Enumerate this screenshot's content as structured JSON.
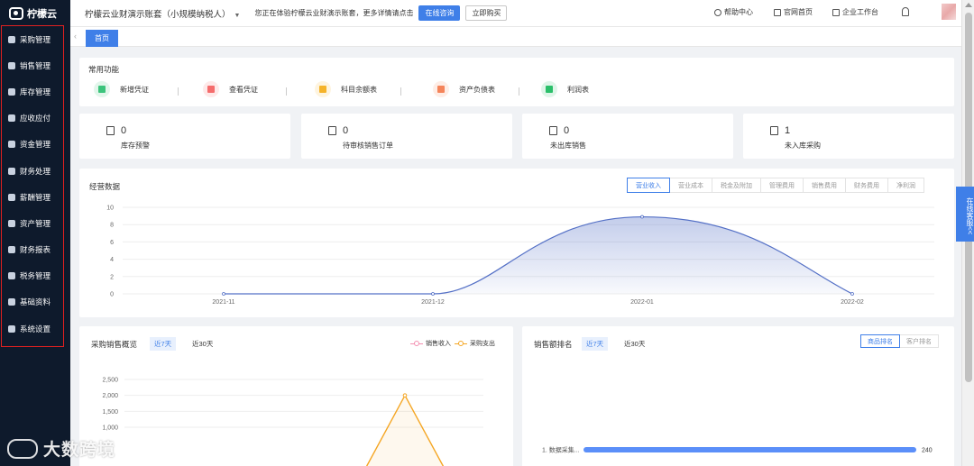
{
  "app": {
    "logo_text": "柠檬云"
  },
  "sidebar": {
    "items": [
      {
        "label": "采购管理",
        "icon": "cart-icon"
      },
      {
        "label": "销售管理",
        "icon": "tag-icon"
      },
      {
        "label": "库存管理",
        "icon": "warehouse-icon"
      },
      {
        "label": "应收应付",
        "icon": "coin-icon"
      },
      {
        "label": "资金管理",
        "icon": "wallet-icon"
      },
      {
        "label": "财务处理",
        "icon": "bank-icon"
      },
      {
        "label": "薪酬管理",
        "icon": "salary-icon"
      },
      {
        "label": "资产管理",
        "icon": "asset-icon"
      },
      {
        "label": "财务报表",
        "icon": "report-icon"
      },
      {
        "label": "税务管理",
        "icon": "tax-icon"
      },
      {
        "label": "基础资料",
        "icon": "database-icon"
      },
      {
        "label": "系统设置",
        "icon": "gear-icon"
      }
    ]
  },
  "topbar": {
    "company": "柠檬云业财演示账套（小规模纳税人）",
    "notice": "您正在体验柠檬云业财演示账套，更多详情请点击",
    "consult_btn": "在线咨询",
    "buy_btn": "立即购买",
    "help": "帮助中心",
    "website": "官网首页",
    "workbench": "企业工作台"
  },
  "tabs": {
    "home": "首页"
  },
  "quick": {
    "title": "常用功能",
    "items": [
      {
        "label": "新增凭证",
        "color": "#3cc47c"
      },
      {
        "label": "查看凭证",
        "color": "#f56c6c"
      },
      {
        "label": "科目余额表",
        "color": "#f5b32a"
      },
      {
        "label": "资产负债表",
        "color": "#f5845a"
      },
      {
        "label": "利润表",
        "color": "#2bbf6a"
      }
    ]
  },
  "stats": [
    {
      "value": "0",
      "label": "库存预警"
    },
    {
      "value": "0",
      "label": "待审核销售订单"
    },
    {
      "value": "0",
      "label": "未出库销售"
    },
    {
      "value": "1",
      "label": "未入库采购"
    }
  ],
  "business": {
    "title": "经营数据",
    "tabs": [
      "营业收入",
      "营业成本",
      "税金及附加",
      "管理费用",
      "销售费用",
      "财务费用",
      "净利润"
    ],
    "active_tab": "营业收入"
  },
  "purchase": {
    "title": "采购销售概览",
    "range_on": "近7天",
    "range_off": "近30天",
    "legend_sales": "销售收入",
    "legend_purchase": "采购支出"
  },
  "sales_rank": {
    "title": "销售额排名",
    "range_on": "近7天",
    "range_off": "近30天",
    "tab_goods": "商品排名",
    "tab_customer": "客户排名",
    "item_label": "1. 数据采集...",
    "item_value": "240"
  },
  "service_tab": "在线客服<<",
  "watermark": "大数跨境",
  "chart_data": [
    {
      "type": "area",
      "categories": [
        "2021-11",
        "2021-12",
        "2022-01",
        "2022-02"
      ],
      "values": [
        0,
        0,
        8.9,
        0
      ],
      "ylim": [
        0,
        10
      ],
      "yticks": [
        0,
        2,
        4,
        6,
        8,
        10
      ],
      "color": "#5470c6",
      "grid": true
    },
    {
      "type": "line",
      "yticks": [
        "1,000",
        "1,500",
        "2,000",
        "2,500"
      ],
      "ylim": [
        1000,
        2500
      ],
      "peak_value": 2000,
      "color": "#f5a623",
      "grid": true
    },
    {
      "type": "bar",
      "categories": [
        "1. 数据采集..."
      ],
      "values": [
        240
      ],
      "color": "#5b8ff9"
    }
  ]
}
